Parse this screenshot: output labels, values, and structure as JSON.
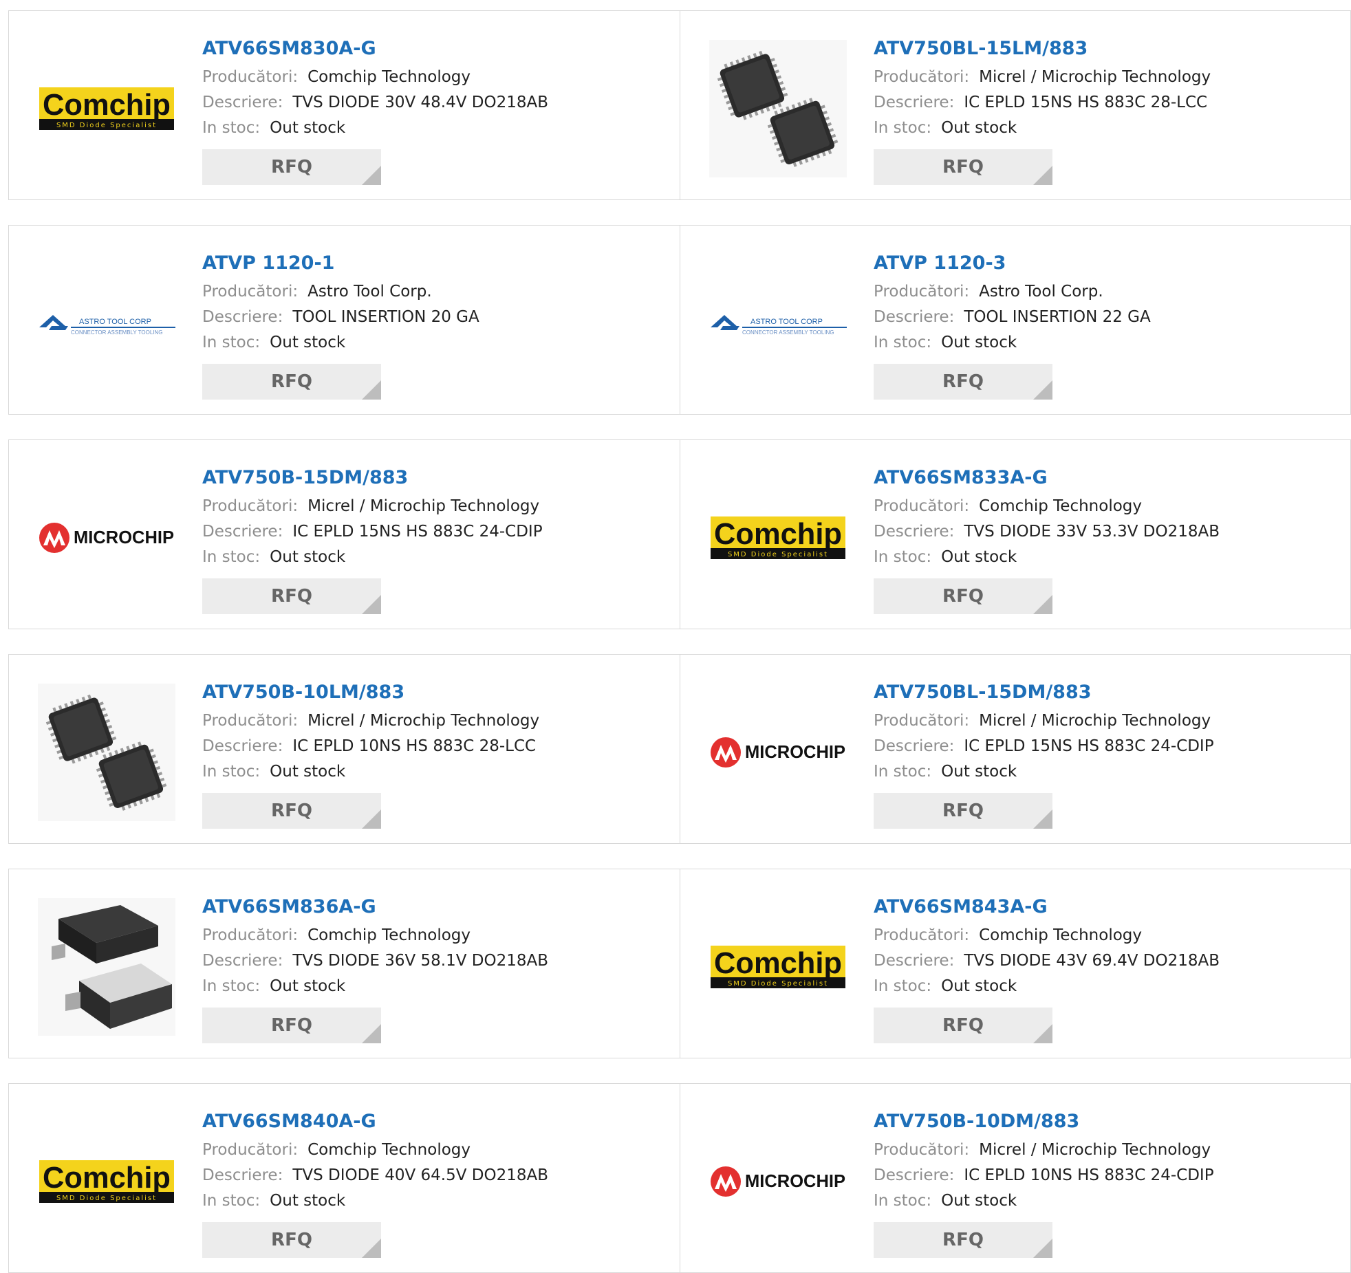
{
  "labels": {
    "manufacturer": "Producători:",
    "description": "Descriere:",
    "stock": "In stoc:",
    "rfq": "RFQ"
  },
  "logo_texts": {
    "comchip": "Comchip",
    "comchip_tagline": "SMD Diode Specialist",
    "microchip": "MICROCHIP",
    "astro": "ASTRO TOOL CORP",
    "astro_tagline": "CONNECTOR ASSEMBLY TOOLING"
  },
  "colors": {
    "link": "#1e6fb8",
    "label": "#8e8e8e",
    "value": "#222222",
    "button_bg": "#ececec",
    "comchip_yellow": "#f4d31c",
    "microchip_red": "#e3302f",
    "astro_blue": "#1d5fa8"
  },
  "products": [
    {
      "part": "ATV66SM830A-G",
      "manufacturer": "Comchip Technology",
      "description": "TVS DIODE 30V 48.4V DO218AB",
      "stock": "Out stock",
      "image": "comchip-logo"
    },
    {
      "part": "ATV750BL-15LM/883",
      "manufacturer": "Micrel / Microchip Technology",
      "description": "IC EPLD 15NS HS 883C 28-LCC",
      "stock": "Out stock",
      "image": "plcc-chip-photo"
    },
    {
      "part": "ATVP 1120-1",
      "manufacturer": "Astro Tool Corp.",
      "description": "TOOL INSERTION 20 GA",
      "stock": "Out stock",
      "image": "astro-tool-logo"
    },
    {
      "part": "ATVP 1120-3",
      "manufacturer": "Astro Tool Corp.",
      "description": "TOOL INSERTION 22 GA",
      "stock": "Out stock",
      "image": "astro-tool-logo"
    },
    {
      "part": "ATV750B-15DM/883",
      "manufacturer": "Micrel / Microchip Technology",
      "description": "IC EPLD 15NS HS 883C 24-CDIP",
      "stock": "Out stock",
      "image": "microchip-logo"
    },
    {
      "part": "ATV66SM833A-G",
      "manufacturer": "Comchip Technology",
      "description": "TVS DIODE 33V 53.3V DO218AB",
      "stock": "Out stock",
      "image": "comchip-logo"
    },
    {
      "part": "ATV750B-10LM/883",
      "manufacturer": "Micrel / Microchip Technology",
      "description": "IC EPLD 10NS HS 883C 28-LCC",
      "stock": "Out stock",
      "image": "plcc-chip-photo"
    },
    {
      "part": "ATV750BL-15DM/883",
      "manufacturer": "Micrel / Microchip Technology",
      "description": "IC EPLD 15NS HS 883C 24-CDIP",
      "stock": "Out stock",
      "image": "microchip-logo"
    },
    {
      "part": "ATV66SM836A-G",
      "manufacturer": "Comchip Technology",
      "description": "TVS DIODE 36V 58.1V DO218AB",
      "stock": "Out stock",
      "image": "do218-package-photo"
    },
    {
      "part": "ATV66SM843A-G",
      "manufacturer": "Comchip Technology",
      "description": "TVS DIODE 43V 69.4V DO218AB",
      "stock": "Out stock",
      "image": "comchip-logo"
    },
    {
      "part": "ATV66SM840A-G",
      "manufacturer": "Comchip Technology",
      "description": "TVS DIODE 40V 64.5V DO218AB",
      "stock": "Out stock",
      "image": "comchip-logo"
    },
    {
      "part": "ATV750B-10DM/883",
      "manufacturer": "Micrel / Microchip Technology",
      "description": "IC EPLD 10NS HS 883C 24-CDIP",
      "stock": "Out stock",
      "image": "microchip-logo"
    }
  ]
}
